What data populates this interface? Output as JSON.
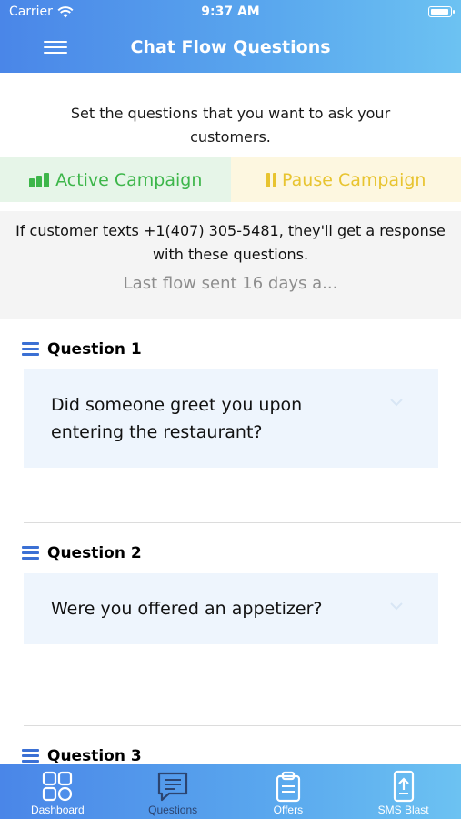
{
  "status": {
    "carrier": "Carrier",
    "time": "9:37 AM"
  },
  "nav": {
    "title": "Chat Flow Questions"
  },
  "intro": {
    "text": "Set the questions that you want to ask your customers."
  },
  "campaign": {
    "active_label": "Active Campaign",
    "pause_label": "Pause Campaign",
    "active_color": "#3db64a",
    "pause_color": "#e8c430"
  },
  "info": {
    "text": "If customer texts +1(407) 305-5481, they'll get a response with these questions.",
    "last_flow": "Last flow sent 16 days a..."
  },
  "questions": [
    {
      "label": "Question 1",
      "text": "Did someone greet you upon entering the restaurant?"
    },
    {
      "label": "Question 2",
      "text": "Were you offered an appetizer?"
    },
    {
      "label": "Question 3",
      "text": ""
    }
  ],
  "tabs": [
    {
      "label": "Dashboard",
      "icon": "dashboard-icon",
      "active": false
    },
    {
      "label": "Questions",
      "icon": "chat-questions-icon",
      "active": true
    },
    {
      "label": "Offers",
      "icon": "clipboard-icon",
      "active": false
    },
    {
      "label": "SMS Blast",
      "icon": "phone-upload-icon",
      "active": false
    }
  ],
  "colors": {
    "brand_blue": "#4a86e8",
    "accent_blue": "#3b70d4",
    "active_tab": "#2c4470"
  }
}
